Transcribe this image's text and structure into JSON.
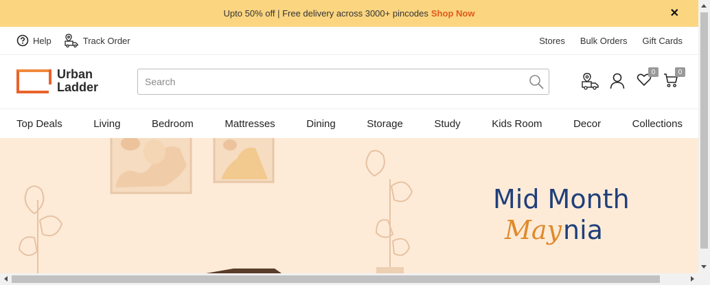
{
  "promo": {
    "text": "Upto 50% off | Free delivery across 3000+ pincodes",
    "link": "Shop Now",
    "close": "✕"
  },
  "utility": {
    "help": "Help",
    "track_order": "Track Order",
    "stores": "Stores",
    "bulk_orders": "Bulk Orders",
    "gift_cards": "Gift Cards"
  },
  "header": {
    "logo_line1": "Urban",
    "logo_line2": "Ladder",
    "search_placeholder": "Search",
    "wishlist_count": "0",
    "cart_count": "0"
  },
  "nav": {
    "items": [
      "Top Deals",
      "Living",
      "Bedroom",
      "Mattresses",
      "Dining",
      "Storage",
      "Study",
      "Kids Room",
      "Decor",
      "Collections"
    ]
  },
  "hero": {
    "title": "Mid Month",
    "sub_script": "May",
    "sub_rest": "nia"
  },
  "colors": {
    "promo_bg": "#fbd580",
    "accent": "#e05a1b",
    "hero_bg": "#fdebd8",
    "hero_title": "#1f3f7a",
    "hero_script": "#e08a2a"
  }
}
